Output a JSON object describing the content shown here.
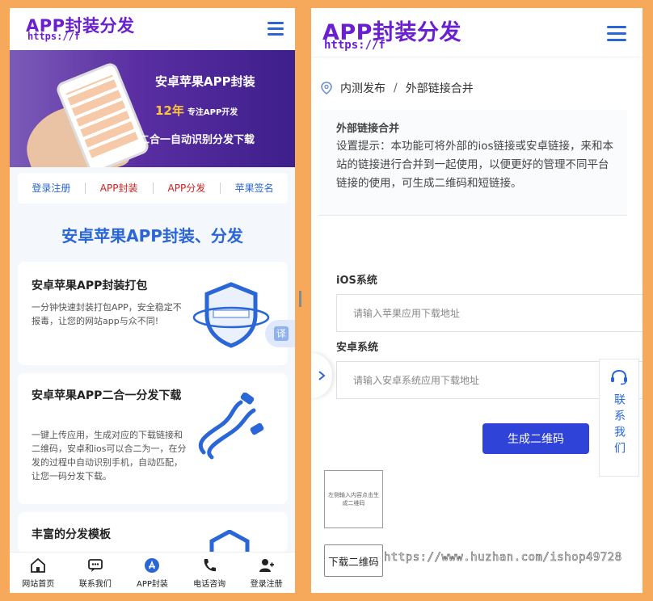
{
  "left": {
    "header": {
      "logo_title": "APP封装分发",
      "logo_url": "https://f"
    },
    "banner": {
      "line1": "安卓苹果APP封装",
      "highlight": "12年",
      "highlight_sub": "专注APP开发",
      "line3": "二合一自动识别分发下载"
    },
    "nav": [
      "登录注册",
      "APP封装",
      "APP分发",
      "苹果签名"
    ],
    "section_title": "安卓苹果APP封装、分发",
    "cards": [
      {
        "title": "安卓苹果APP封装打包",
        "desc": "一分钟快速封装打包APP，安全稳定不报毒，让您的网站app与众不同!"
      },
      {
        "title": "安卓苹果APP二合一分发下载",
        "desc": "一键上传应用，生成对应的下载链接和二维码，安卓和ios可以合二为一，在分发的过程中自动识别手机，自动匹配，让您一码分发下载。"
      },
      {
        "title": "丰富的分发模板"
      }
    ],
    "translate_label": "译",
    "tabbar": [
      {
        "label": "网站首页",
        "icon": "home-icon"
      },
      {
        "label": "联系我们",
        "icon": "chat-icon"
      },
      {
        "label": "APP封装",
        "icon": "app-store-icon"
      },
      {
        "label": "电话咨询",
        "icon": "phone-icon"
      },
      {
        "label": "登录注册",
        "icon": "user-icon"
      }
    ],
    "accent_color": "#2a66d6"
  },
  "right": {
    "header": {
      "logo_title": "APP封装分发",
      "logo_url": "https://f"
    },
    "breadcrumb": [
      "内测发布",
      "/",
      "外部链接合并"
    ],
    "intro": {
      "title": "外部链接合并",
      "text": "设置提示：本功能可将外部的ios链接或安卓链接，来和本站的链接进行合并到一起使用，以便更好的管理不同平台链接的使用，可生成二维码和短链接。"
    },
    "ios": {
      "label": "iOS系统",
      "placeholder": "请输入苹果应用下载地址"
    },
    "android": {
      "label": "安卓系统",
      "placeholder": "请输入安卓系统应用下载地址"
    },
    "generate_button": "生成二维码",
    "qr_placeholder": "左侧输入内容点击生成二维码",
    "download_button": "下载二维码",
    "contact_float": "联系我们",
    "watermark": "https://www.huzhan.com/ishop49728",
    "button_color": "#2f43d8"
  }
}
